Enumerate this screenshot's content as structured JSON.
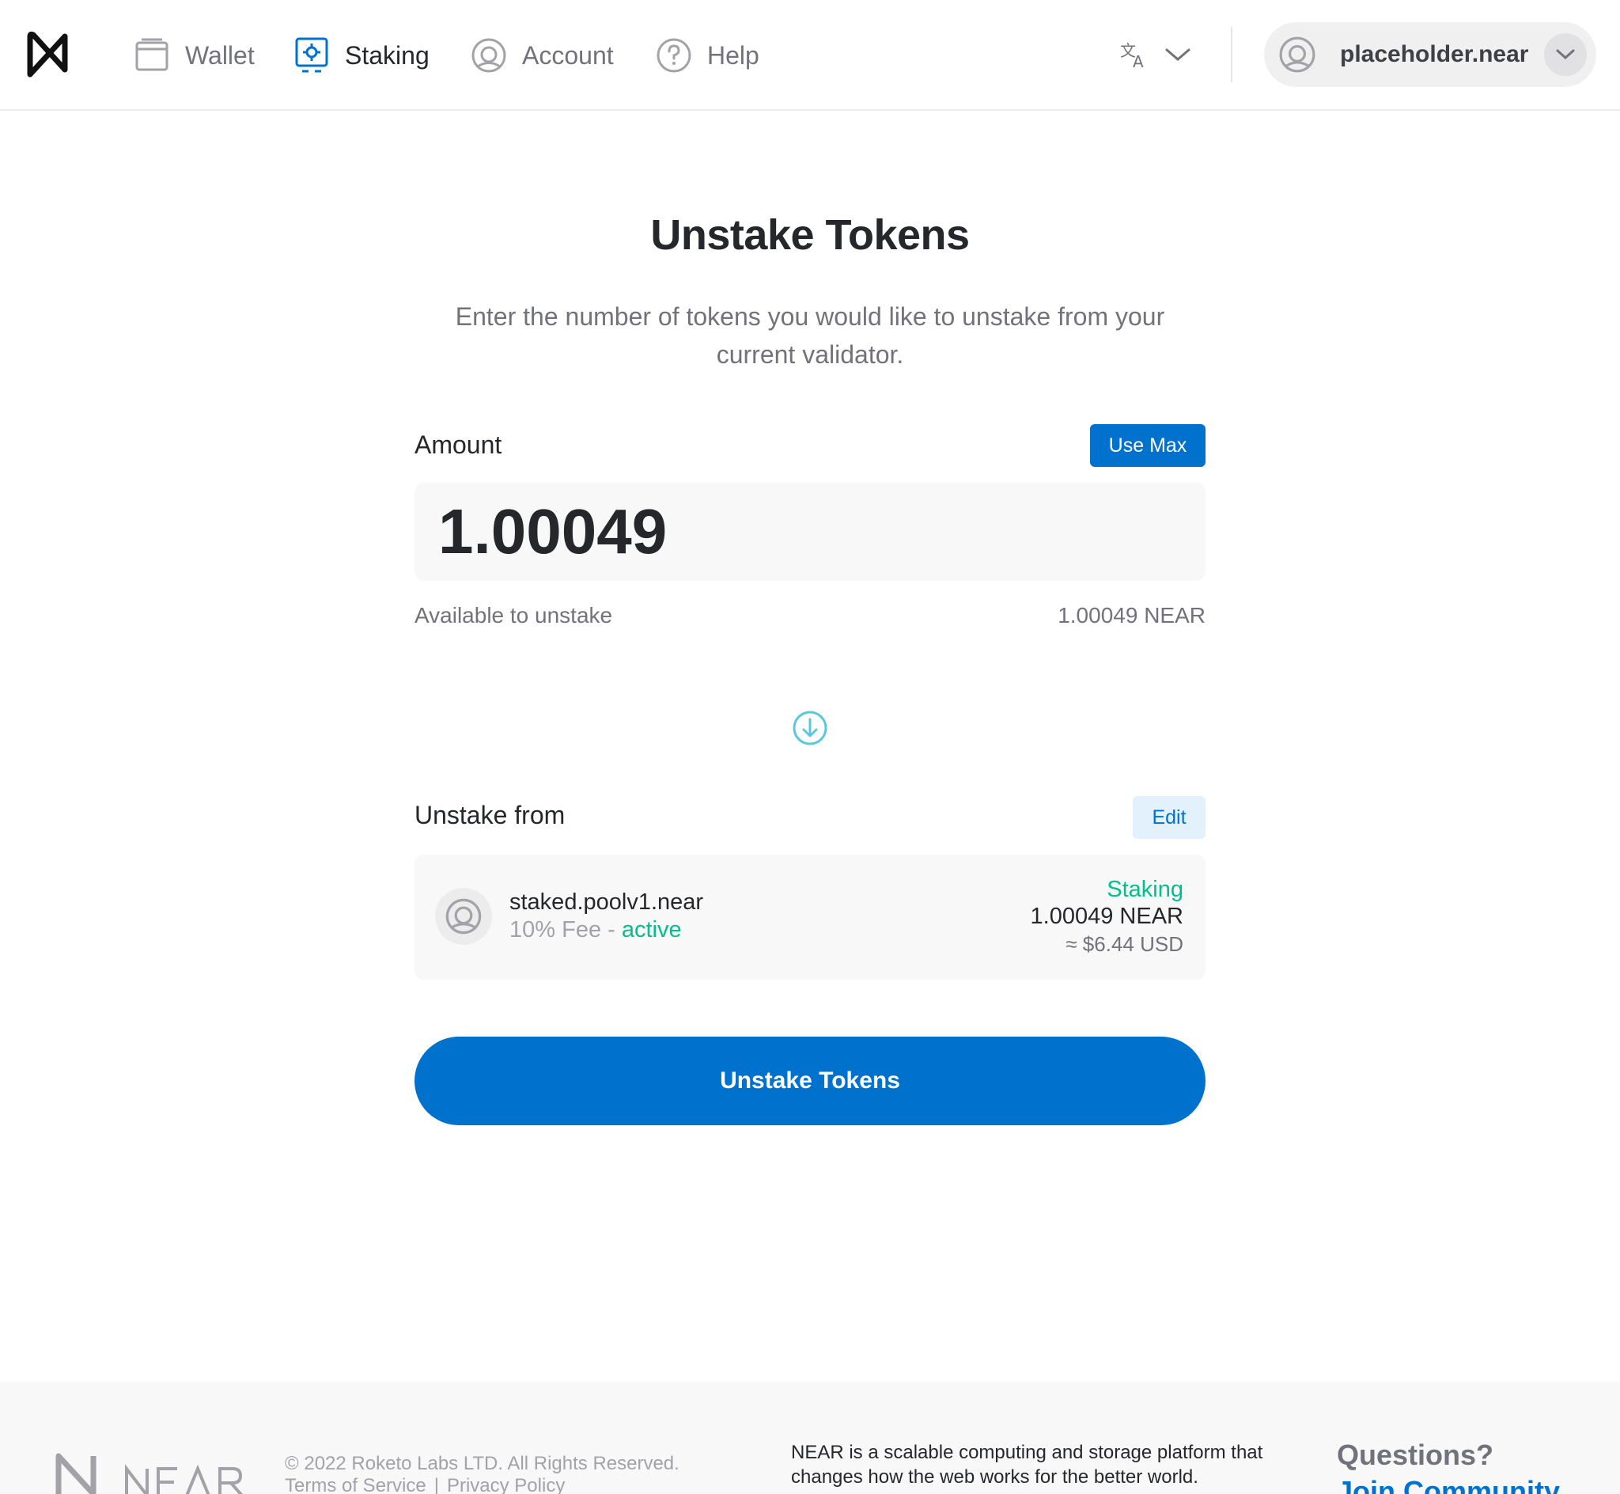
{
  "nav": {
    "items": [
      {
        "label": "Wallet",
        "icon": "wallet-icon"
      },
      {
        "label": "Staking",
        "icon": "staking-icon",
        "active": true
      },
      {
        "label": "Account",
        "icon": "account-icon"
      },
      {
        "label": "Help",
        "icon": "help-icon"
      }
    ],
    "language_icon": "translate-icon",
    "account_name": "placeholder.near"
  },
  "main": {
    "title": "Unstake Tokens",
    "description": "Enter the number of tokens you would like to unstake from your current validator.",
    "amount_label": "Amount",
    "use_max_label": "Use Max",
    "amount_value": "1.00049",
    "available_label": "Available to unstake",
    "available_value": "1.00049 NEAR",
    "unstake_from_label": "Unstake from",
    "edit_label": "Edit",
    "validator": {
      "name": "staked.poolv1.near",
      "fee": "10% Fee - ",
      "status": "active",
      "staking_label": "Staking",
      "amount": "1.00049 NEAR",
      "usd": "≈ $6.44 USD"
    },
    "submit_label": "Unstake Tokens"
  },
  "footer": {
    "copyright": "© 2022 Roketo Labs LTD. All Rights Reserved.",
    "terms": "Terms of Service",
    "privacy": "Privacy Policy",
    "about": "NEAR is a scalable computing and storage platform that changes how the web works for the better world.",
    "questions": "Questions?",
    "join": "Join Community"
  },
  "colors": {
    "accent": "#0072ce",
    "active_green": "#00c08b",
    "muted_text": "#72727a",
    "panel_bg": "#f8f8f8"
  }
}
